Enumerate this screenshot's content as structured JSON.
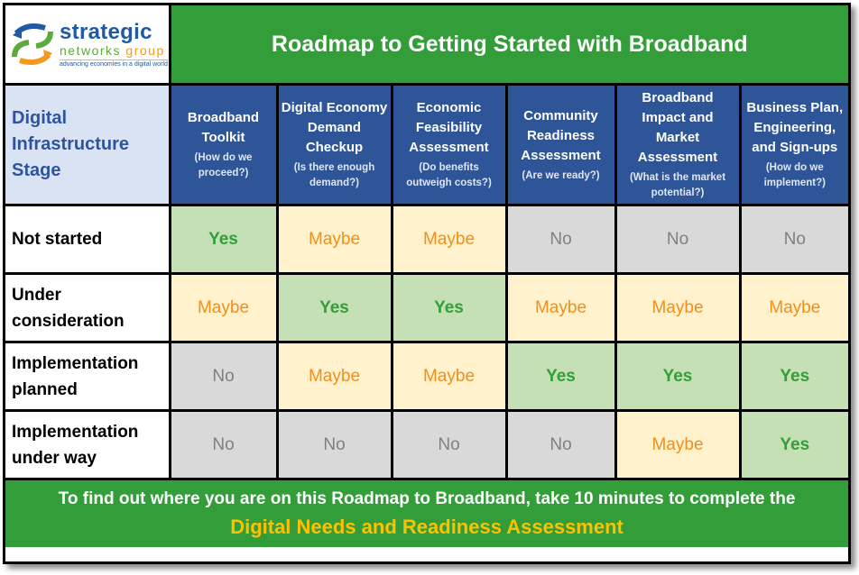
{
  "logo": {
    "name_line1": "strategic",
    "name_line2a": "networks ",
    "name_line2b": "group",
    "tagline": "advancing economies in a digital world"
  },
  "title": "Roadmap to Getting Started with Broadband",
  "corner_label": "Digital Infrastructure Stage",
  "columns": [
    {
      "title": "Broadband Toolkit",
      "question": "(How do we proceed?)"
    },
    {
      "title": "Digital Economy Demand Checkup",
      "question": "(Is there enough demand?)"
    },
    {
      "title": "Economic Feasibility Assessment",
      "question": "(Do benefits outweigh costs?)"
    },
    {
      "title": "Community Readiness Assessment",
      "question": "(Are we ready?)"
    },
    {
      "title": "Broadband Impact and Market Assessment",
      "question": "(What is the market potential?)"
    },
    {
      "title": "Business Plan, Engineering, and Sign-ups",
      "question": "(How do we implement?)"
    }
  ],
  "rows": [
    {
      "label": "Not started",
      "values": [
        "Yes",
        "Maybe",
        "Maybe",
        "No",
        "No",
        "No"
      ]
    },
    {
      "label": "Under consideration",
      "values": [
        "Maybe",
        "Yes",
        "Yes",
        "Maybe",
        "Maybe",
        "Maybe"
      ]
    },
    {
      "label": "Implementation planned",
      "values": [
        "No",
        "Maybe",
        "Maybe",
        "Yes",
        "Yes",
        "Yes"
      ]
    },
    {
      "label": "Implementation under way",
      "values": [
        "No",
        "No",
        "No",
        "No",
        "Maybe",
        "Yes"
      ]
    }
  ],
  "footer": {
    "text": "To find out where you are on this Roadmap to Broadband, take 10 minutes to complete the",
    "link": "Digital Needs and Readiness Assessment"
  },
  "colors": {
    "title_green": "#339e39",
    "header_blue": "#2e5597",
    "yes_bg": "#c5e0b4",
    "yes_text": "#31a03a",
    "maybe_bg": "#fff2cc",
    "maybe_text": "#f28e1a",
    "no_bg": "#d9d9d9",
    "no_text": "#808080",
    "link_gold": "#ffc000"
  }
}
